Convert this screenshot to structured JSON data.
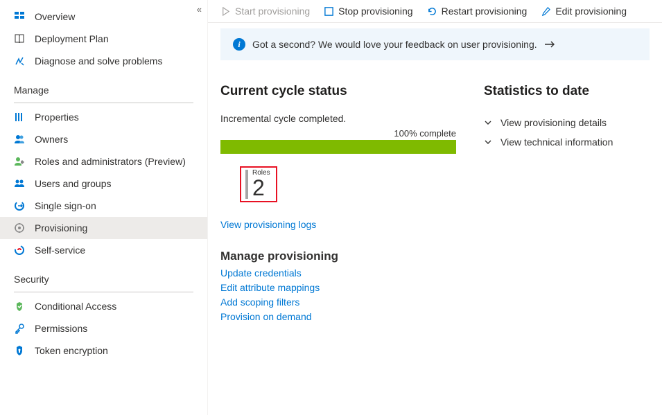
{
  "sidebar": {
    "top": [
      {
        "label": "Overview"
      },
      {
        "label": "Deployment Plan"
      },
      {
        "label": "Diagnose and solve problems"
      }
    ],
    "manage_header": "Manage",
    "manage": [
      {
        "label": "Properties"
      },
      {
        "label": "Owners"
      },
      {
        "label": "Roles and administrators (Preview)"
      },
      {
        "label": "Users and groups"
      },
      {
        "label": "Single sign-on"
      },
      {
        "label": "Provisioning"
      },
      {
        "label": "Self-service"
      }
    ],
    "security_header": "Security",
    "security": [
      {
        "label": "Conditional Access"
      },
      {
        "label": "Permissions"
      },
      {
        "label": "Token encryption"
      }
    ]
  },
  "toolbar": {
    "start": "Start provisioning",
    "stop": "Stop provisioning",
    "restart": "Restart provisioning",
    "edit": "Edit provisioning"
  },
  "feedback": "Got a second? We would love your feedback on user provisioning.",
  "cycle": {
    "heading": "Current cycle status",
    "status": "Incremental cycle completed.",
    "progress_label": "100% complete",
    "roles_label": "Roles",
    "roles_count": "2",
    "view_logs": "View provisioning logs"
  },
  "stats": {
    "heading": "Statistics to date",
    "details": "View provisioning details",
    "technical": "View technical information"
  },
  "manage_prov": {
    "heading": "Manage provisioning",
    "links": {
      "update": "Update credentials",
      "mappings": "Edit attribute mappings",
      "scoping": "Add scoping filters",
      "ondemand": "Provision on demand"
    }
  }
}
